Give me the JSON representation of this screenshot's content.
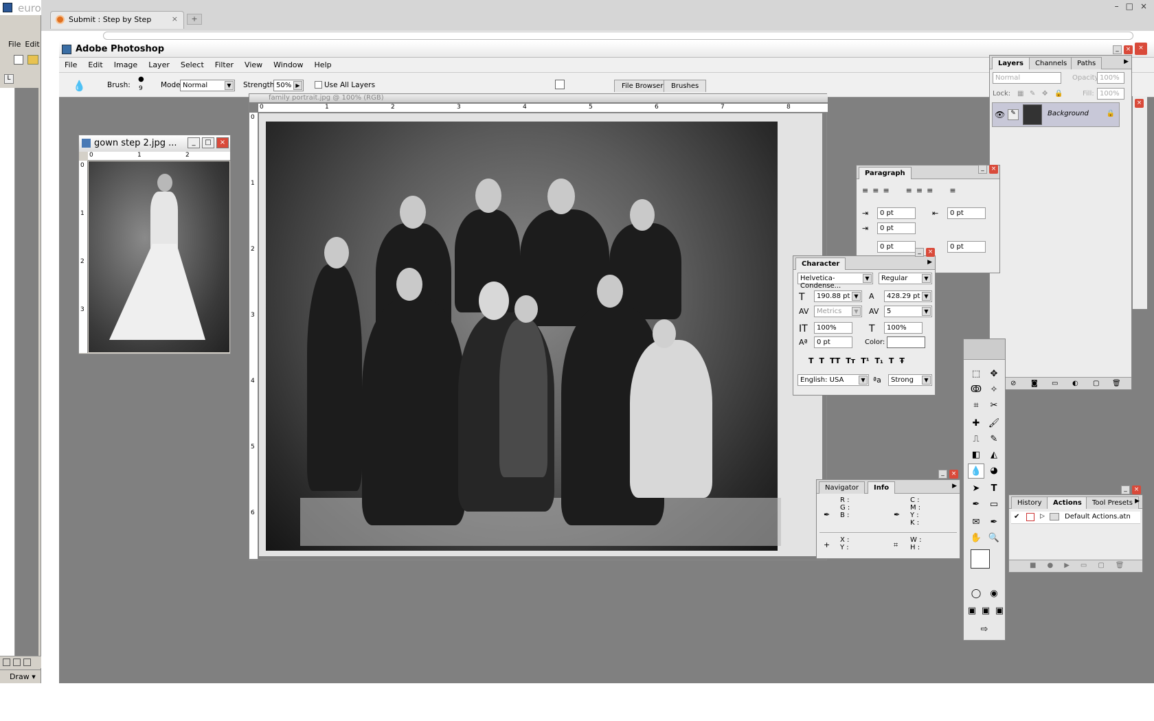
{
  "browser": {
    "tab_title": "Submit : Step by Step",
    "tab_close": "×",
    "new_tab": "+",
    "window_controls": [
      "–",
      "□",
      "×"
    ]
  },
  "word": {
    "title": "euro",
    "menu": [
      "File",
      "Edit"
    ],
    "draw": "Draw ▾"
  },
  "photoshop": {
    "title": "Adobe Photoshop",
    "menu": [
      "File",
      "Edit",
      "Image",
      "Layer",
      "Select",
      "Filter",
      "View",
      "Window",
      "Help"
    ],
    "options": {
      "brush_label": "Brush:",
      "brush_size": "9",
      "mode_label": "Mode:",
      "mode_value": "Normal",
      "strength_label": "Strength:",
      "strength_value": "50%",
      "use_all_layers": "Use All Layers"
    },
    "well_tabs": [
      "File Browser",
      "Brushes"
    ]
  },
  "doc_gown": {
    "title": "gown step 2.jpg ...",
    "ruler_h": [
      "0",
      "1",
      "2"
    ],
    "ruler_v": [
      "0",
      "1",
      "2",
      "3"
    ]
  },
  "doc_family": {
    "title": "family portrait.jpg @ 100% (RGB)",
    "ruler_h": [
      "0",
      "1",
      "2",
      "3",
      "4",
      "5",
      "6",
      "7",
      "8"
    ],
    "ruler_v": [
      "0",
      "1",
      "2",
      "3",
      "4",
      "5",
      "6"
    ]
  },
  "layers_panel": {
    "tabs": [
      "Layers",
      "Channels",
      "Paths"
    ],
    "blend_mode": "Normal",
    "opacity_label": "Opacity:",
    "opacity_value": "100%",
    "lock_label": "Lock:",
    "fill_label": "Fill:",
    "fill_value": "100%",
    "layer_name": "Background"
  },
  "paragraph_panel": {
    "tab": "Paragraph",
    "indent_left": "0 pt",
    "indent_right": "0 pt",
    "first_line": "0 pt",
    "space_before": "0 pt",
    "space_after": "0 pt"
  },
  "character_panel": {
    "tab": "Character",
    "font_family": "Helvetica-Condense...",
    "font_style": "Regular",
    "font_size": "190.88 pt",
    "leading": "428.29 pt",
    "kerning": "Metrics",
    "tracking": "5",
    "vertical_scale": "100%",
    "horizontal_scale": "100%",
    "baseline_shift": "0 pt",
    "color_label": "Color:",
    "language": "English: USA",
    "antialias": "Strong",
    "style_buttons": [
      "T",
      "T",
      "TT",
      "Tт",
      "T¹",
      "T₁",
      "T",
      "Ŧ"
    ]
  },
  "info_panel": {
    "tabs": [
      "Navigator",
      "Info"
    ],
    "rgb_labels": [
      "R :",
      "G :",
      "B :"
    ],
    "cmyk_labels": [
      "C :",
      "M :",
      "Y :",
      "K :"
    ],
    "xy_labels": [
      "X :",
      "Y :"
    ],
    "wh_labels": [
      "W :",
      "H :"
    ]
  },
  "history_panel": {
    "tabs": [
      "History",
      "Actions",
      "Tool Presets"
    ],
    "action_set": "Default Actions.atn"
  },
  "colors": {
    "workspace": "#808080",
    "close_red": "#d94a3a",
    "panel_bg": "#ececec"
  }
}
